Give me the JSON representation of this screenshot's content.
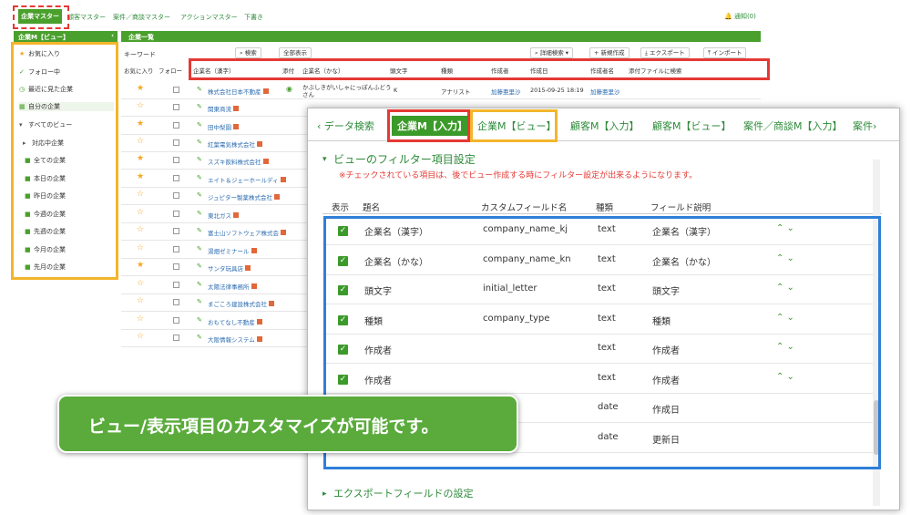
{
  "topnav": {
    "items": [
      "企業マスター",
      "顧客マスター",
      "案件／商談マスター",
      "アクションマスター",
      "下書き"
    ],
    "notice": "通知(0)"
  },
  "sidebar": {
    "header": "企業M【ビュー】",
    "items": [
      "お気に入り",
      "フォロー中",
      "最近に見た企業",
      "自分の企業",
      "すべてのビュー",
      "対応中企業",
      "全ての企業",
      "本日の企業",
      "昨日の企業",
      "今週の企業",
      "先週の企業",
      "今月の企業",
      "先月の企業"
    ]
  },
  "main": {
    "header": "企業一覧",
    "keyword_label": "キーワード",
    "search_label": "検索",
    "show_all_label": "全部表示",
    "detail_search_label": "詳細検索",
    "new_label": "新規作成",
    "export_label": "エクスポート",
    "import_label": "インポート",
    "columns": [
      "お気に入り",
      "フォロー",
      "企業名（漢字）",
      "添付",
      "企業名（かな）",
      "頭文字",
      "種類",
      "作成者",
      "作成日",
      "作成者名",
      "添付ファイルに検索"
    ],
    "first_row": {
      "kana": "かぶしきがいしゃにっぽんふどうさん",
      "initial": "K",
      "type": "アナリスト",
      "creator": "加藤亜里沙",
      "date": "2015-09-25 18:19",
      "creator_name": "加藤亜里沙"
    },
    "companies": [
      "株式会社日本不動産",
      "関東商流",
      "田中梨園",
      "紅葉電気株式会社",
      "スズキ飲料株式会社",
      "エイト＆ジェーホールディ",
      "ジュピター製薬株式会社",
      "東北ガス",
      "富士山ソフトウェア株式会",
      "湯畑ゼミナール",
      "サンタ玩具店",
      "太陽法律事務所",
      "まごころ建設株式会社",
      "おもてなし不動産",
      "大阪情報システム"
    ]
  },
  "modal": {
    "tabs": [
      "データ検索",
      "企業M【入力】",
      "企業M【ビュー】",
      "顧客M【入力】",
      "顧客M【ビュー】",
      "案件／商談M【入力】",
      "案件"
    ],
    "section_title": "ビューのフィルター項目設定",
    "note": "※チェックされている項目は、後でビュー作成する時にフィルター設定が出来るようになります。",
    "headers": [
      "表示",
      "題名",
      "カスタムフィールド名",
      "種類",
      "フィールド説明"
    ],
    "rows": [
      {
        "title": "企業名（漢字）",
        "field": "company_name_kj",
        "type": "text",
        "desc": "企業名（漢字）"
      },
      {
        "title": "企業名（かな）",
        "field": "company_name_kn",
        "type": "text",
        "desc": "企業名（かな）"
      },
      {
        "title": "頭文字",
        "field": "initial_letter",
        "type": "text",
        "desc": "頭文字"
      },
      {
        "title": "種類",
        "field": "company_type",
        "type": "text",
        "desc": "種類"
      },
      {
        "title": "作成者",
        "field": "",
        "type": "text",
        "desc": "作成者"
      },
      {
        "title": "作成者",
        "field": "",
        "type": "text",
        "desc": "作成者"
      },
      {
        "title": "",
        "field": "",
        "type": "date",
        "desc": "作成日"
      },
      {
        "title": "",
        "field": "",
        "type": "date",
        "desc": "更新日"
      }
    ],
    "export_title": "エクスポートフィールドの設定"
  },
  "banner": "ビュー/表示項目のカスタマイズが可能です。"
}
